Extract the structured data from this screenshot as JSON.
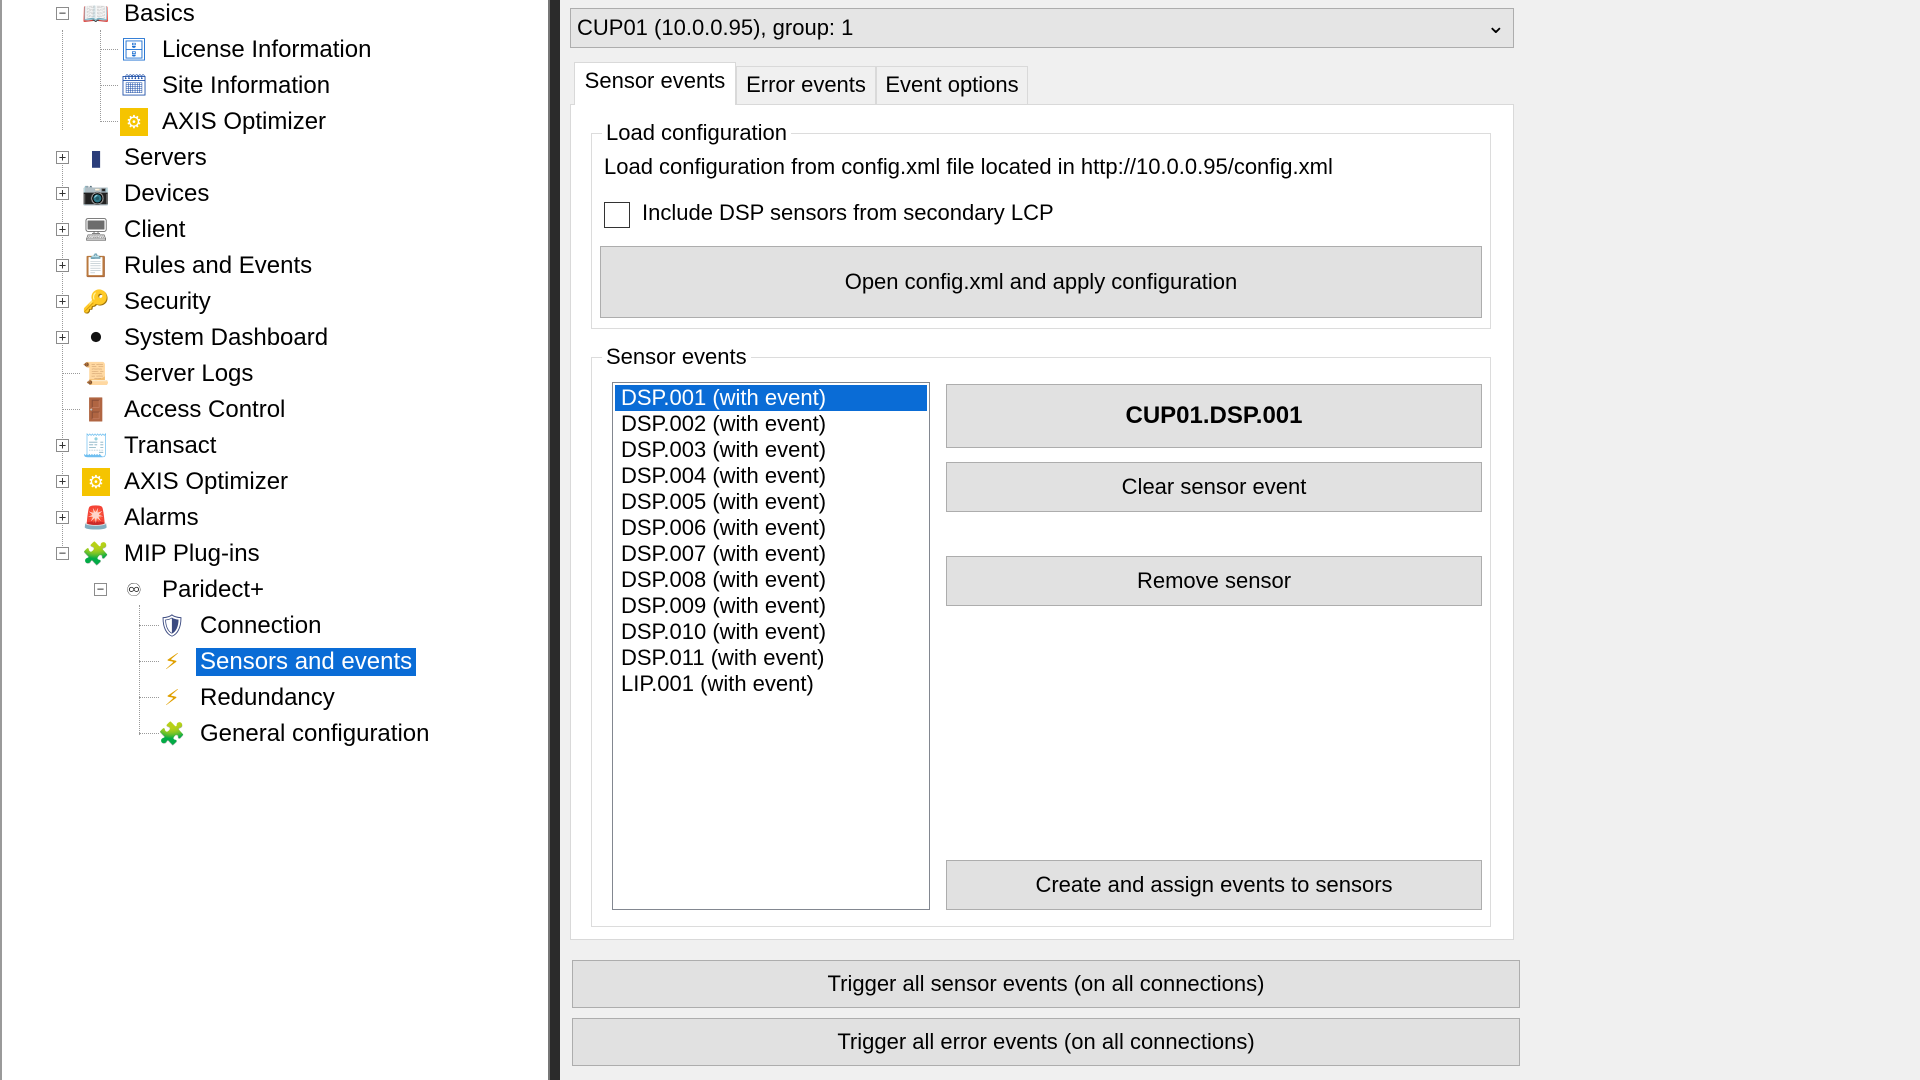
{
  "tree": {
    "items": [
      {
        "label": "Basics",
        "icon": "book-icon",
        "expander": "-"
      },
      {
        "label": "License Information",
        "icon": "license-icon"
      },
      {
        "label": "Site Information",
        "icon": "site-info-icon"
      },
      {
        "label": "AXIS Optimizer",
        "icon": "axis-optimizer-icon"
      },
      {
        "label": "Servers",
        "icon": "server-icon",
        "expander": "+"
      },
      {
        "label": "Devices",
        "icon": "camera-icon",
        "expander": "+"
      },
      {
        "label": "Client",
        "icon": "monitor-icon",
        "expander": "+"
      },
      {
        "label": "Rules and Events",
        "icon": "rules-icon",
        "expander": "+"
      },
      {
        "label": "Security",
        "icon": "key-icon",
        "expander": "+"
      },
      {
        "label": "System Dashboard",
        "icon": "dashboard-icon",
        "expander": "+"
      },
      {
        "label": "Server Logs",
        "icon": "logs-icon"
      },
      {
        "label": "Access Control",
        "icon": "access-control-icon"
      },
      {
        "label": "Transact",
        "icon": "transact-icon",
        "expander": "+"
      },
      {
        "label": "AXIS Optimizer",
        "icon": "axis-optimizer-icon",
        "expander": "+"
      },
      {
        "label": "Alarms",
        "icon": "alarm-icon",
        "expander": "+"
      },
      {
        "label": "MIP Plug-ins",
        "icon": "plugin-icon",
        "expander": "-"
      },
      {
        "label": "Paridect+",
        "icon": "paridect-icon",
        "expander": "-"
      },
      {
        "label": "Connection",
        "icon": "connection-icon"
      },
      {
        "label": "Sensors and events",
        "icon": "lightning-icon",
        "selected": true
      },
      {
        "label": "Redundancy",
        "icon": "lightning-icon"
      },
      {
        "label": "General configuration",
        "icon": "plugin-icon"
      }
    ]
  },
  "connection_select": {
    "value": "CUP01 (10.0.0.95), group: 1"
  },
  "tabs": [
    {
      "label": "Sensor events",
      "active": true
    },
    {
      "label": "Error events"
    },
    {
      "label": "Event options"
    }
  ],
  "load_config": {
    "title": "Load configuration",
    "description": "Load configuration from config.xml file located in http://10.0.0.95/config.xml",
    "checkbox_label": "Include DSP sensors from secondary LCP",
    "checkbox_checked": false,
    "open_button": "Open config.xml and apply configuration"
  },
  "sensor_events": {
    "title": "Sensor events",
    "items": [
      "DSP.001 (with event)",
      "DSP.002 (with event)",
      "DSP.003 (with event)",
      "DSP.004 (with event)",
      "DSP.005 (with event)",
      "DSP.006 (with event)",
      "DSP.007 (with event)",
      "DSP.008 (with event)",
      "DSP.009 (with event)",
      "DSP.010 (with event)",
      "DSP.011 (with event)",
      "LIP.001 (with event)"
    ],
    "selected_index": 0,
    "selected_sensor_name": "CUP01.DSP.001",
    "clear_button": "Clear sensor event",
    "remove_button": "Remove sensor",
    "create_button": "Create and assign events to sensors"
  },
  "footer": {
    "trigger_sensor_button": "Trigger all sensor events (on all connections)",
    "trigger_error_button": "Trigger all error events (on all connections)"
  },
  "colors": {
    "selection": "#0a6cd6",
    "button_bg": "#e1e1e1",
    "panel_bg": "#f0f0f0"
  }
}
